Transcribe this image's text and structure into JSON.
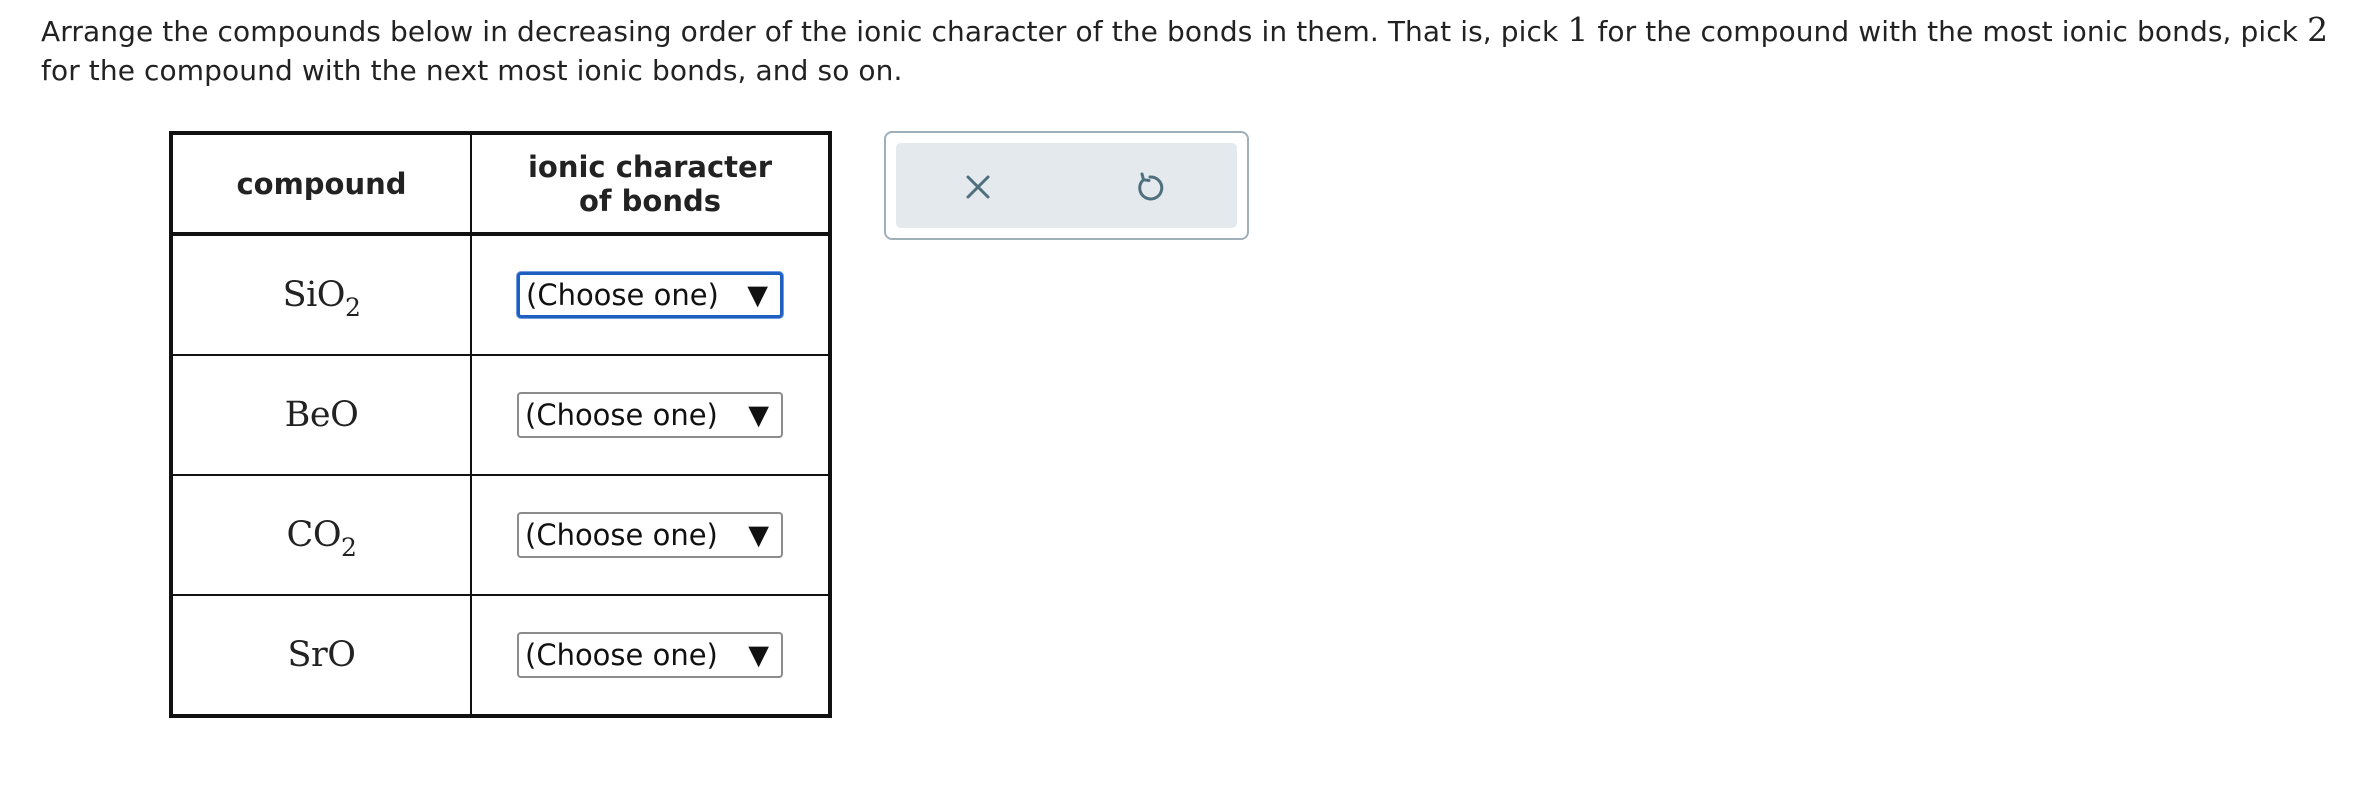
{
  "instructions": {
    "part1": "Arrange the compounds below in decreasing order of the ionic character of the bonds in them. That is, pick ",
    "num1": "1",
    "part2": " for the compound with the most ionic bonds, pick ",
    "num2": "2",
    "part3": " for the compound with the next most ionic bonds, and so on."
  },
  "table": {
    "headers": {
      "compound": "compound",
      "ionic_line1": "ionic character",
      "ionic_line2": "of bonds"
    },
    "rows": [
      {
        "formula": "SiO",
        "subscript": "2",
        "selected": "(Choose one)"
      },
      {
        "formula": "BeO",
        "subscript": "",
        "selected": "(Choose one)"
      },
      {
        "formula": "CO",
        "subscript": "2",
        "selected": "(Choose one)"
      },
      {
        "formula": "SrO",
        "subscript": "",
        "selected": "(Choose one)"
      }
    ]
  },
  "dropdown_arrow": "▼",
  "tools": {
    "close_icon": "close-icon",
    "undo_icon": "undo-icon",
    "icon_color": "#4f6f7f"
  },
  "colors": {
    "focus_border": "#1f5fbf",
    "tool_background": "#e3e9ec"
  }
}
